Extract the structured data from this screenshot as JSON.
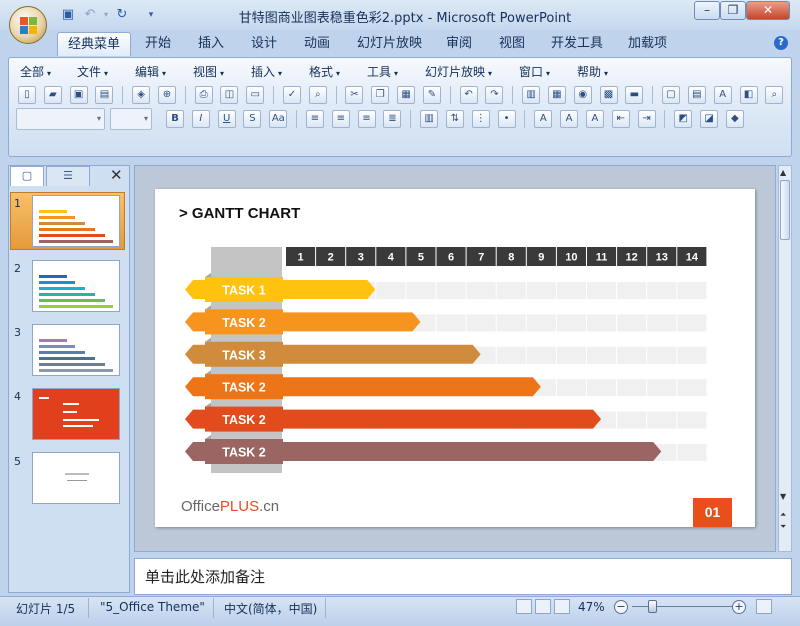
{
  "window": {
    "title": "甘特图商业图表稳重色彩2.pptx - Microsoft PowerPoint",
    "minimize": "–",
    "restore": "❐",
    "close": "✕"
  },
  "tabs": [
    "经典菜单",
    "开始",
    "插入",
    "设计",
    "动画",
    "幻灯片放映",
    "审阅",
    "视图",
    "开发工具",
    "加载项"
  ],
  "active_tab": "经典菜单",
  "menus": [
    "全部",
    "文件",
    "编辑",
    "视图",
    "插入",
    "格式",
    "工具",
    "幻灯片放映",
    "窗口",
    "帮助"
  ],
  "left_panel": {
    "tab_slides": "▢",
    "tab_outline": "☰",
    "close": "✕",
    "thumbnails": [
      {
        "num": "1",
        "selected": true
      },
      {
        "num": "2",
        "selected": false
      },
      {
        "num": "3",
        "selected": false
      },
      {
        "num": "4",
        "selected": false
      },
      {
        "num": "5",
        "selected": false
      }
    ]
  },
  "slide": {
    "title": "> GANTT CHART",
    "logo_prefix": "Office",
    "logo_plus": "PLUS",
    "logo_suffix": ".cn",
    "page_badge": "01"
  },
  "chart_data": {
    "type": "bar",
    "title": "> GANTT CHART",
    "x_ticks": [
      "1",
      "2",
      "3",
      "4",
      "5",
      "6",
      "7",
      "8",
      "9",
      "10",
      "11",
      "12",
      "13",
      "14"
    ],
    "categories": [
      "TASK 1",
      "TASK 2",
      "TASK 3",
      "TASK 2",
      "TASK 2",
      "TASK 2"
    ],
    "values": [
      3,
      4.5,
      6.5,
      8.5,
      10.5,
      12.5
    ],
    "colors": [
      "#ffc20e",
      "#f7941d",
      "#d18b3c",
      "#ee7418",
      "#e24b1c",
      "#9b6563"
    ],
    "xlim": [
      0,
      14
    ],
    "grid": true
  },
  "notes": {
    "placeholder": "单击此处添加备注"
  },
  "status": {
    "slide": "幻灯片 1/5",
    "theme": "\"5_Office Theme\"",
    "language": "中文(简体，中国)",
    "zoom": "47%",
    "zoom_minus": "−",
    "zoom_plus": "+"
  }
}
